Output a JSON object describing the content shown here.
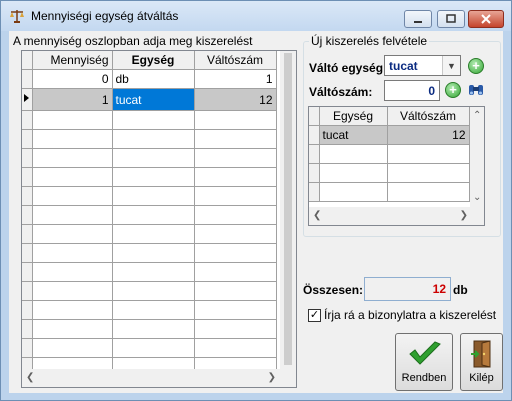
{
  "window": {
    "title": "Mennyiségi egység átváltás"
  },
  "left_panel": {
    "caption": "A mennyiség oszlopban adja meg kiszerelést",
    "columns": [
      "Mennyiség",
      "Egység",
      "Váltószám"
    ],
    "rows": [
      {
        "mennyiseg": "0",
        "egyseg": "db",
        "valtoszam": "1"
      },
      {
        "mennyiseg": "1",
        "egyseg": "tucat",
        "valtoszam": "12"
      }
    ]
  },
  "new_pack": {
    "group_title": "Új kiszerelés felvétele",
    "unit_label": "Váltó egység",
    "unit_value": "tucat",
    "rate_label": "Váltószám:",
    "rate_value": "0",
    "columns": [
      "Egység",
      "Váltószám"
    ],
    "rows": [
      {
        "egyseg": "tucat",
        "valtoszam": "12"
      }
    ]
  },
  "total": {
    "label": "Összesen:",
    "value": "12",
    "unit": "db"
  },
  "print_checkbox": {
    "label": "Írja rá a bizonylatra a kiszerelést",
    "checked": true
  },
  "buttons": {
    "ok": "Rendben",
    "exit": "Kilép"
  },
  "colors": {
    "selection": "#0078d7",
    "total_value": "#cc0000",
    "accent": "#31a531"
  }
}
